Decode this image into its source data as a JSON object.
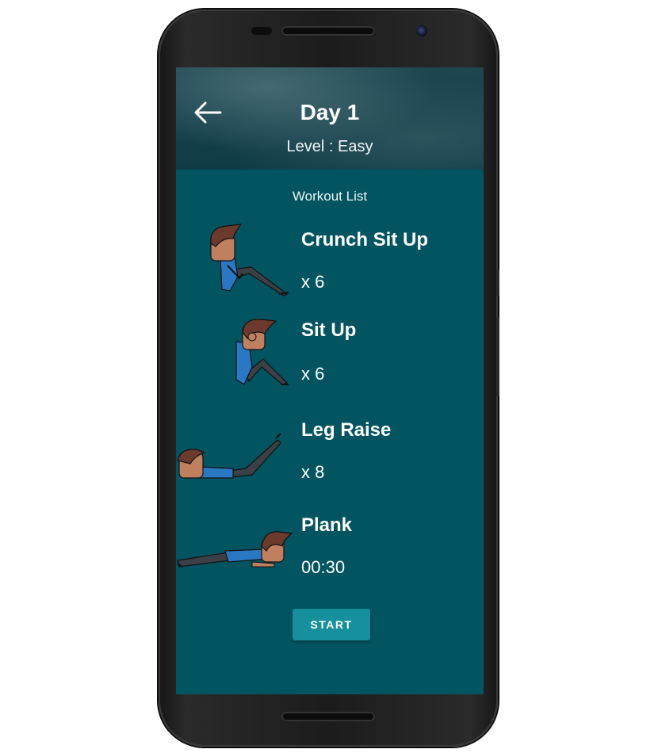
{
  "header": {
    "title": "Day 1",
    "level": "Level : Easy",
    "back_icon": "arrow-left-icon"
  },
  "workout": {
    "list_title": "Workout List",
    "items": [
      {
        "name": "Crunch Sit Up",
        "reps": "x 6",
        "image": "crunch-sit-up-figure"
      },
      {
        "name": "Sit Up",
        "reps": "x 6",
        "image": "sit-up-figure"
      },
      {
        "name": "Leg Raise",
        "reps": "x 8",
        "image": "leg-raise-figure"
      },
      {
        "name": "Plank",
        "reps": "00:30",
        "image": "plank-figure"
      }
    ]
  },
  "actions": {
    "start_label": "START"
  },
  "colors": {
    "screen_bg": "#015460",
    "button_bg": "#16909c",
    "shirt": "#2a78c4",
    "pants": "#3b3f46",
    "skin": "#c08060",
    "hair": "#6b3a2c"
  }
}
